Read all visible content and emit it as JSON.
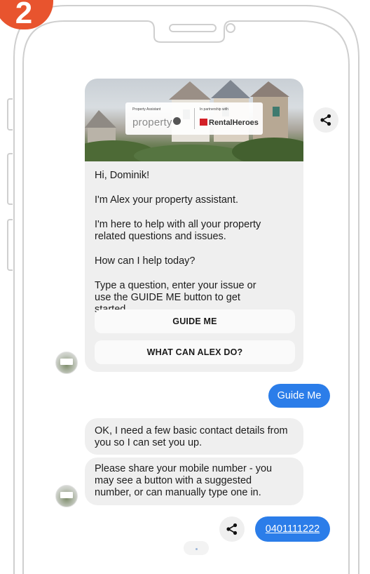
{
  "step_badge": "2",
  "banner": {
    "assistant_caption": "Property Assistant",
    "partner_caption": "In partnership with",
    "pm_logo": "property",
    "pm_logo_mark": "me",
    "rh_logo": "RentalHeroes"
  },
  "bot_main": {
    "greeting": "Hi, Dominik!",
    "intro": "I'm Alex your property assistant.",
    "help": "I'm here to help with all your property related questions and issues.",
    "question": "How can I help today?",
    "instructions": "Type a question, enter your issue or use the GUIDE ME button to get started.",
    "guide_me_label": "GUIDE ME",
    "what_can_label": "WHAT CAN ALEX DO?"
  },
  "user_reply_1": "Guide Me",
  "bot_msg_1": "OK, I need a few basic contact details from you so I can set you up.",
  "bot_msg_2": "Please share your mobile number - you may see a button with a suggested number, or can manually type one in.",
  "user_reply_2": "0401111222",
  "colors": {
    "accent": "#2b7de9",
    "badge": "#e8542e",
    "bubble_grey": "#efefef"
  },
  "icons": [
    "share-icon",
    "avatar-icon"
  ]
}
